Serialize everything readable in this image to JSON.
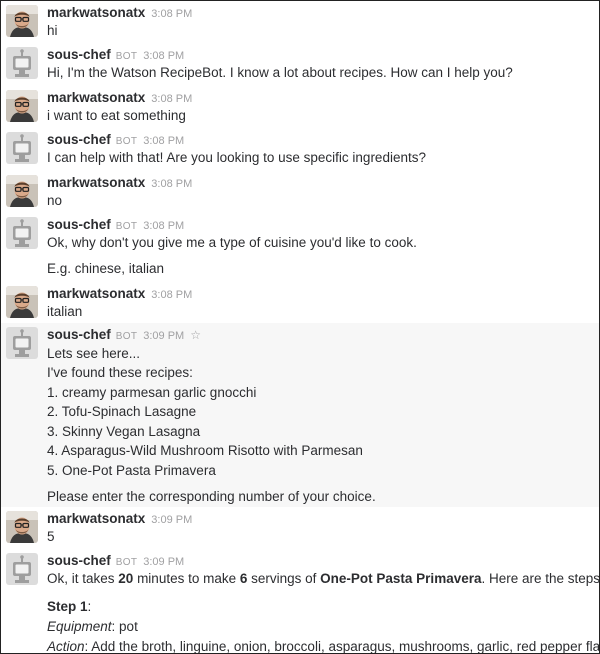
{
  "users": {
    "human": "markwatsonatx",
    "bot": "sous-chef",
    "bot_badge": "BOT"
  },
  "icons": {
    "human_avatar": "user-photo-avatar",
    "bot_avatar": "robot-avatar",
    "star": "star-icon"
  },
  "messages": [
    {
      "time": "3:08 PM",
      "text": "hi"
    },
    {
      "time": "3:08 PM",
      "text": "Hi, I'm the Watson RecipeBot. I know a lot about recipes. How can I help you?"
    },
    {
      "time": "3:08 PM",
      "text": "i want to eat something"
    },
    {
      "time": "3:08 PM",
      "text": "I can help with that! Are you looking to use specific ingredients?"
    },
    {
      "time": "3:08 PM",
      "text": "no"
    },
    {
      "time": "3:08 PM",
      "text": "Ok, why don't you give me a type of cuisine you'd like to cook.",
      "text2": "E.g. chinese, italian"
    },
    {
      "time": "3:08 PM",
      "text": "italian"
    },
    {
      "time": "3:09 PM",
      "intro1": "Lets see here...",
      "intro2": "I've found these recipes:",
      "recipes": [
        "1. creamy parmesan garlic gnocchi",
        "2. Tofu-Spinach Lasagne",
        "3. Skinny Vegan Lasagna",
        "4. Asparagus-Wild Mushroom Risotto with Parmesan",
        "5. One-Pot Pasta Primavera"
      ],
      "prompt": "Please enter the corresponding number of your choice."
    },
    {
      "time": "3:09 PM",
      "text": "5"
    },
    {
      "time": "3:09 PM",
      "p1": "Ok, it takes ",
      "minutes": "20",
      "p2": " minutes to make ",
      "servings": "6",
      "p3": " servings of ",
      "recipe": "One-Pot Pasta Primavera",
      "p4": ". Here are the steps:",
      "step_label": "Step 1",
      "step_colon": ":",
      "equipment_label": "Equipment",
      "equipment_value": ": pot",
      "action_label": "Action",
      "action_value": ": Add the broth, linguine, onion, broccoli, asparagus, mushrooms, garlic, red pepper flakes,"
    }
  ]
}
